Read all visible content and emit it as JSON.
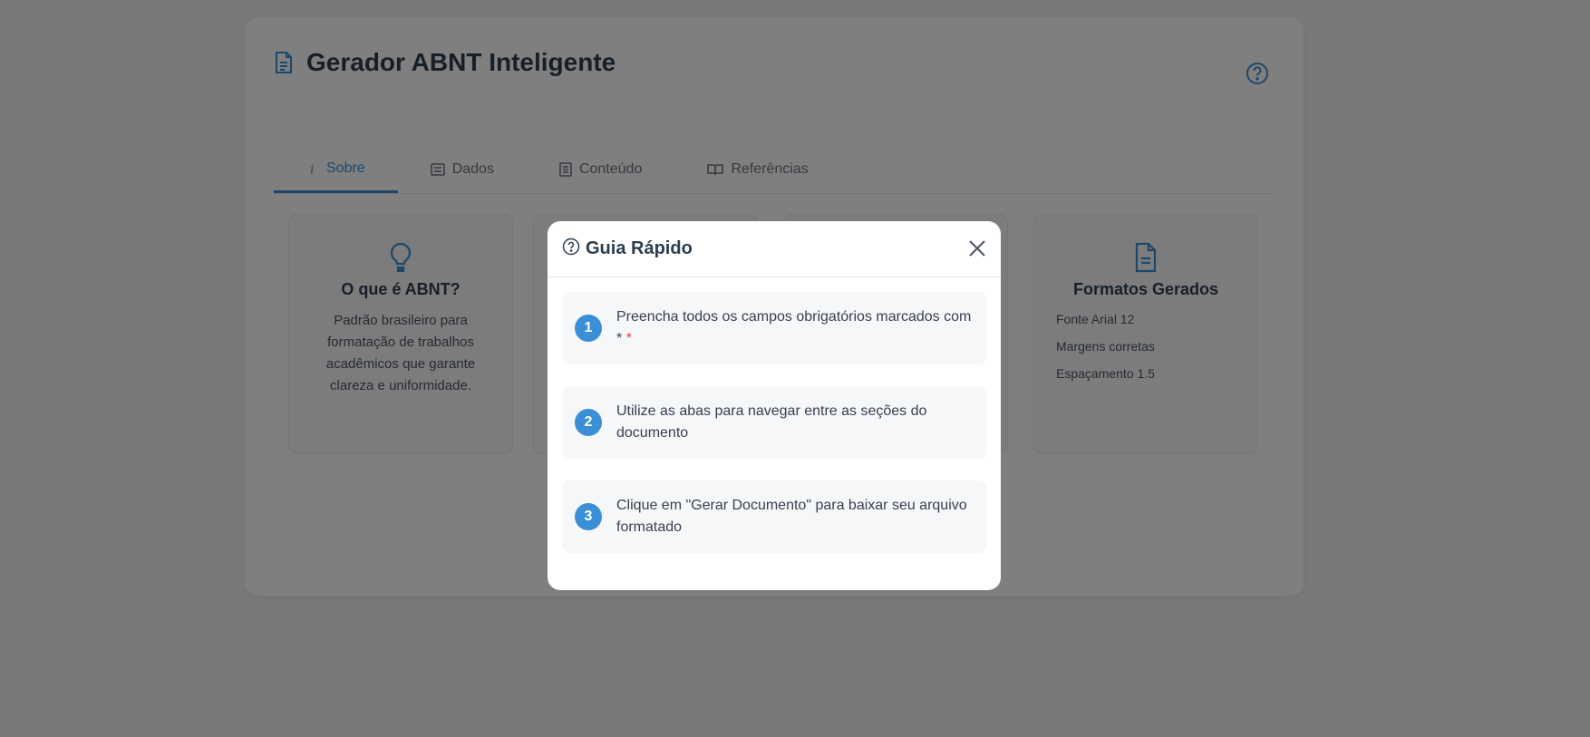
{
  "app": {
    "title": "Gerador ABNT Inteligente"
  },
  "tabs": [
    {
      "label": "Sobre",
      "icon": "info-icon",
      "active": true
    },
    {
      "label": "Dados",
      "icon": "form-icon",
      "active": false
    },
    {
      "label": "Conteúdo",
      "icon": "document-list-icon",
      "active": false
    },
    {
      "label": "Referências",
      "icon": "book-icon",
      "active": false
    }
  ],
  "cards": [
    {
      "icon": "lightbulb-icon",
      "title": "O que é ABNT?",
      "description": "Padrão brasileiro para formatação de trabalhos acadêmicos que garante clareza e uniformidade."
    },
    {
      "icon": "document-icon",
      "title": "Formatos Gerados",
      "items": [
        "Fonte Arial 12",
        "Margens corretas",
        "Espaçamento 1.5"
      ]
    }
  ],
  "modal": {
    "title": "Guia Rápido",
    "steps": [
      {
        "number": "1",
        "text": "Preencha todos os campos obrigatórios marcados com",
        "marker": "*",
        "marker_red": "*"
      },
      {
        "number": "2",
        "text": "Utilize as abas para navegar entre as seções do documento"
      },
      {
        "number": "3",
        "text": "Clique em \"Gerar Documento\" para baixar seu arquivo formatado"
      }
    ]
  },
  "colors": {
    "accent": "#3a8fd6",
    "title": "#2c3e50",
    "required": "#e53e3e"
  }
}
